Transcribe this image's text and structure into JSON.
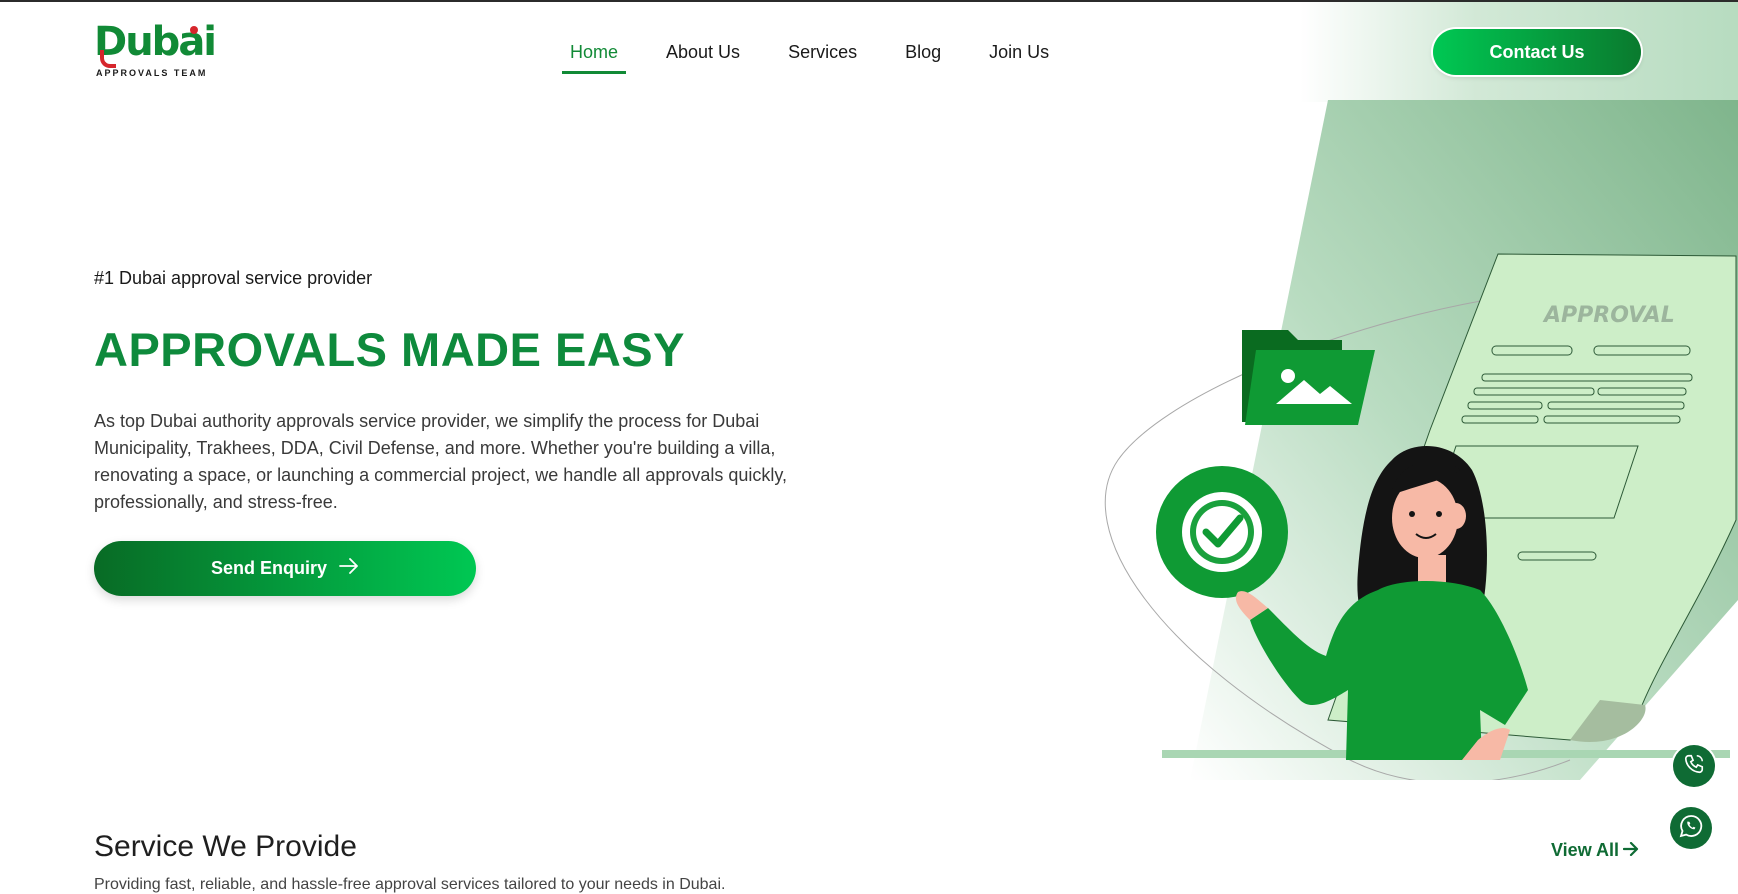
{
  "brand": {
    "logo_word": "Dubai",
    "logo_tagline": "APPROVALS TEAM",
    "primary_color": "#118a36",
    "accent_red": "#d6262c"
  },
  "nav": {
    "items": [
      {
        "label": "Home",
        "active": true
      },
      {
        "label": "About Us",
        "active": false
      },
      {
        "label": "Services",
        "active": false
      },
      {
        "label": "Blog",
        "active": false
      },
      {
        "label": "Join Us",
        "active": false
      }
    ]
  },
  "header": {
    "contact_label": "Contact Us"
  },
  "hero": {
    "eyebrow": "#1 Dubai approval service provider",
    "title": "APPROVALS MADE EASY",
    "description": "As top Dubai authority approvals service provider, we simplify the process for Dubai Municipality, Trakhees, DDA, Civil Defense, and more. Whether you're building a villa, renovating a space, or launching a commercial project, we handle all approvals quickly, professionally, and stress-free.",
    "cta_label": "Send Enquiry",
    "cta_icon": "arrow-right-icon",
    "illustration_doc_label": "APPROVAL"
  },
  "services": {
    "title": "Service We Provide",
    "subtitle": "Providing fast, reliable, and hassle-free approval services tailored to your needs in Dubai.",
    "view_all_label": "View All",
    "view_all_icon": "arrow-right-icon"
  },
  "floating": {
    "phone_icon": "phone-icon",
    "whatsapp_icon": "whatsapp-icon"
  }
}
